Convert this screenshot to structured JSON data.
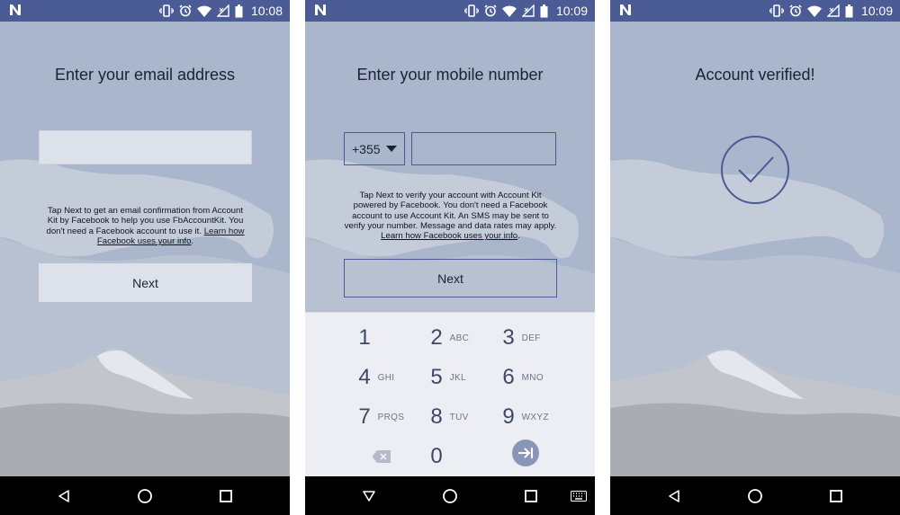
{
  "colors": {
    "status_bar": "#4a5b96",
    "background_sky": "#a9b6cb",
    "accent": "#4a5b96",
    "keypad_bg": "#eceef3",
    "nav_bar": "#000000"
  },
  "screens": [
    {
      "status": {
        "time": "10:08"
      },
      "title": "Enter your email address",
      "email_value": "",
      "info_text": "Tap Next to get an email confirmation from Account Kit by Facebook to help you use FbAccountKit. You don't need a Facebook account to use it.",
      "info_link": "Learn how Facebook uses your info",
      "info_end": ".",
      "next_label": "Next"
    },
    {
      "status": {
        "time": "10:09"
      },
      "title": "Enter your mobile number",
      "country_code": "+355",
      "phone_value": "",
      "info_text": "Tap Next to verify your account with Account Kit powered by Facebook. You don't need a Facebook account to use Account Kit. An SMS may be sent to verify your number. Message and data rates may apply.",
      "info_link": "Learn how Facebook uses your info",
      "info_end": ".",
      "next_label": "Next",
      "keypad": [
        {
          "num": "1",
          "letters": ""
        },
        {
          "num": "2",
          "letters": "ABC"
        },
        {
          "num": "3",
          "letters": "DEF"
        },
        {
          "num": "4",
          "letters": "GHI"
        },
        {
          "num": "5",
          "letters": "JKL"
        },
        {
          "num": "6",
          "letters": "MNO"
        },
        {
          "num": "7",
          "letters": "PRQS"
        },
        {
          "num": "8",
          "letters": "TUV"
        },
        {
          "num": "9",
          "letters": "WXYZ"
        },
        {
          "num": "0",
          "letters": ""
        }
      ],
      "keypad_icons": [
        "backspace-icon",
        "next-field-icon"
      ]
    },
    {
      "status": {
        "time": "10:09"
      },
      "title": "Account verified!",
      "icon": "check-circle-icon"
    }
  ],
  "status_icons": [
    "notification-n-icon",
    "vibrate-icon",
    "alarm-icon",
    "wifi-icon",
    "signal-icon",
    "battery-icon"
  ],
  "nav_icons": [
    "back-icon",
    "home-icon",
    "recents-icon",
    "keyboard-icon"
  ]
}
